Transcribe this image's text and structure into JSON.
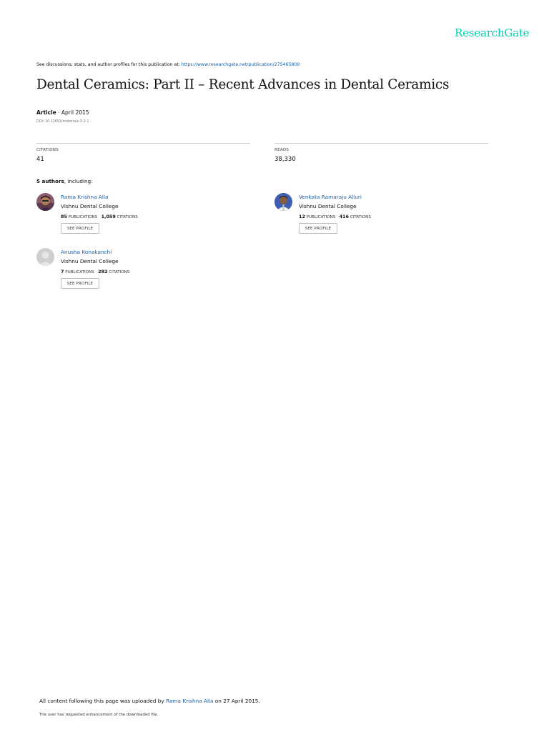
{
  "brand": {
    "logo_text": "ResearchGate",
    "accent": "#00d0af",
    "link_color": "#1a5fa3"
  },
  "header": {
    "discuss_text": "See discussions, stats, and author profiles for this publication at: ",
    "publication_url": "https://www.researchgate.net/publication/275465809"
  },
  "publication": {
    "title": "Dental Ceramics: Part II – Recent Advances in Dental Ceramics",
    "type": "Article",
    "date": " · April 2015",
    "doi": "DOI: 10.12691/materials-3-2-1"
  },
  "stats": {
    "citations_label": "CITATIONS",
    "citations_value": "41",
    "reads_label": "READS",
    "reads_value": "38,330"
  },
  "authors_section": {
    "count_bold": "5 authors",
    "suffix": ", including:"
  },
  "authors": [
    {
      "name": "Rama Krishna Alla",
      "institution": "Vishnu Dental College",
      "publications": "85",
      "publications_label": " PUBLICATIONS",
      "citations": "1,059",
      "citations_label": " CITATIONS",
      "button": "SEE PROFILE",
      "avatar_icon": "person-photo-icon"
    },
    {
      "name": "Venkata Ramaraju Alluri",
      "institution": "Vishnu Dental College",
      "publications": "12",
      "publications_label": " PUBLICATIONS",
      "citations": "416",
      "citations_label": " CITATIONS",
      "button": "SEE PROFILE",
      "avatar_icon": "person-photo-icon"
    },
    {
      "name": "Anusha Konakanchi",
      "institution": "Vishnu Dental College",
      "publications": "7",
      "publications_label": " PUBLICATIONS",
      "citations": "282",
      "citations_label": " CITATIONS",
      "button": "SEE PROFILE",
      "avatar_icon": "default-avatar-icon"
    }
  ],
  "footer": {
    "upload_prefix": "All content following this page was uploaded by ",
    "uploader": "Rama Krishna Alla",
    "upload_suffix": " on 27 April 2015.",
    "enhancement_note": "The user has requested enhancement of the downloaded file."
  }
}
